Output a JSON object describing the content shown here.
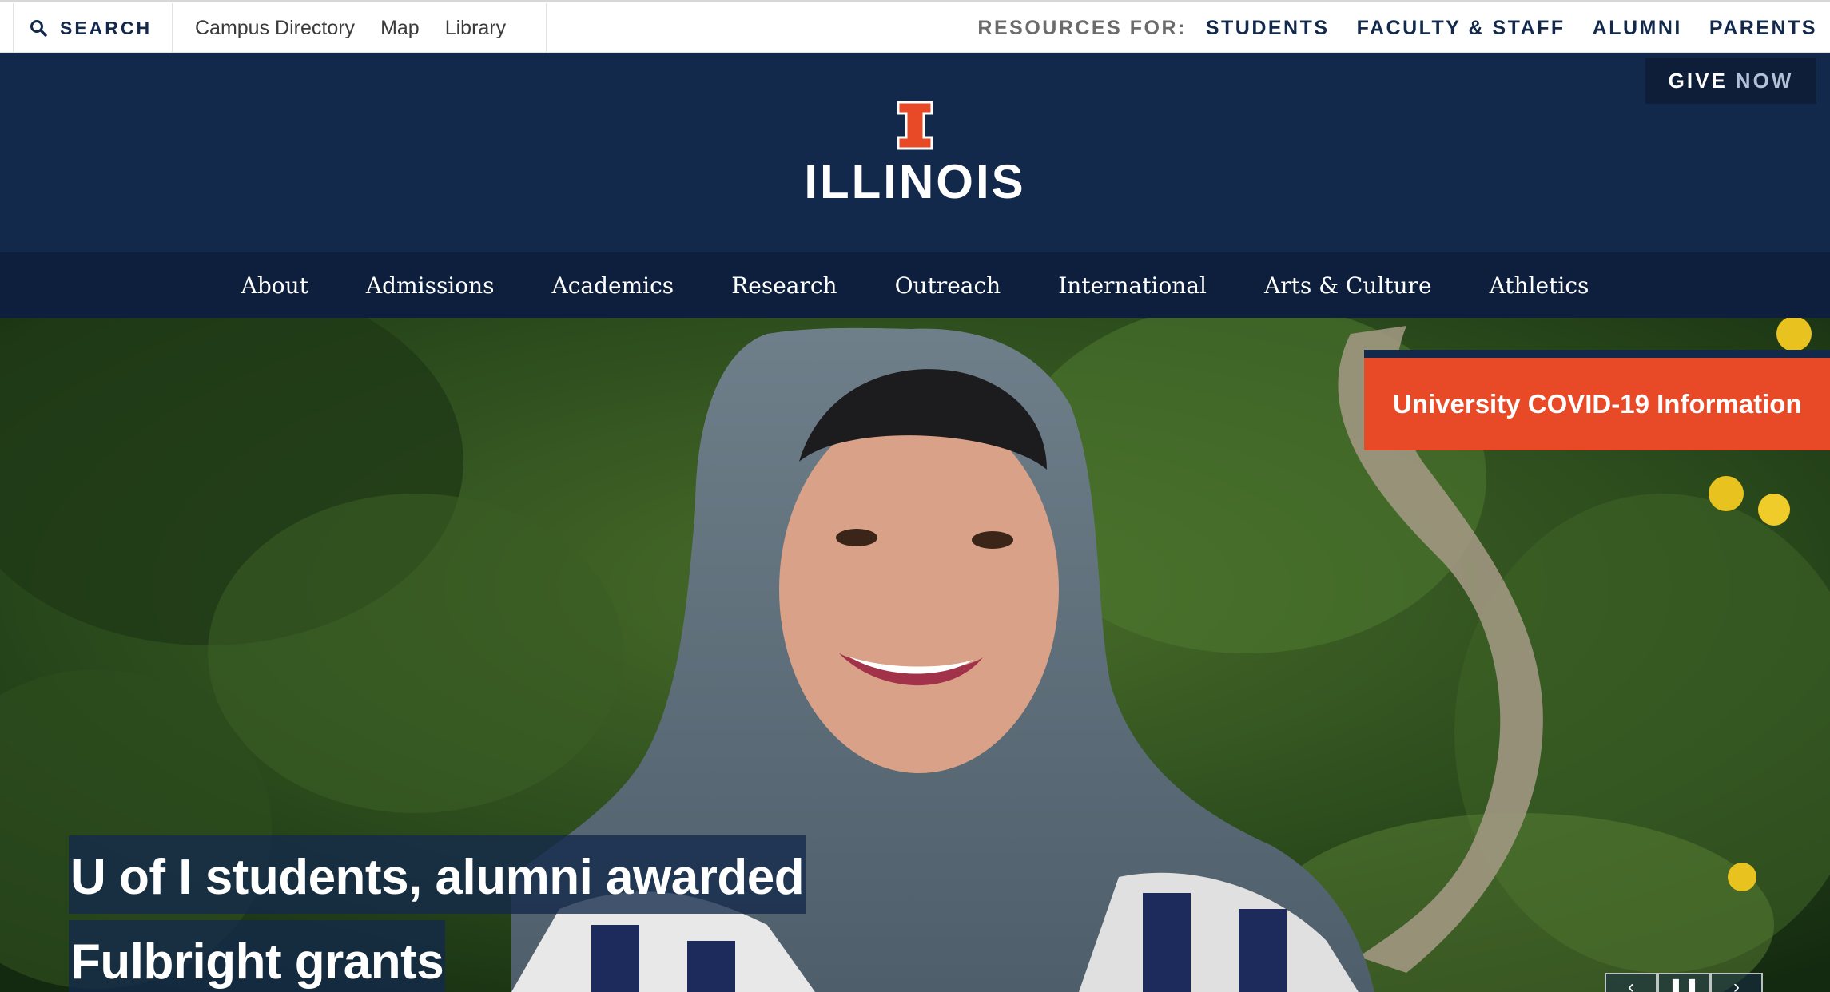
{
  "utility": {
    "search_label": "SEARCH",
    "links": [
      "Campus Directory",
      "Map",
      "Library"
    ],
    "resources_label": "RESOURCES FOR:",
    "resources": [
      "STUDENTS",
      "FACULTY & STAFF",
      "ALUMNI",
      "PARENTS"
    ]
  },
  "header": {
    "give_label_1": "GIVE",
    "give_label_2": "NOW",
    "wordmark": "ILLINOIS",
    "logo_icon": "block-i-logo"
  },
  "nav": {
    "items": [
      "About",
      "Admissions",
      "Academics",
      "Research",
      "Outreach",
      "International",
      "Arts & Culture",
      "Athletics"
    ]
  },
  "hero": {
    "covid_label": "University COVID-19 Information",
    "headline_line1": "U of I students, alumni awarded",
    "headline_line2": "Fulbright grants",
    "controls": [
      "prev-icon",
      "pause-icon",
      "next-icon"
    ]
  },
  "colors": {
    "navy": "#13294b",
    "dark_navy": "#0d1f3d",
    "orange": "#e84a27"
  }
}
